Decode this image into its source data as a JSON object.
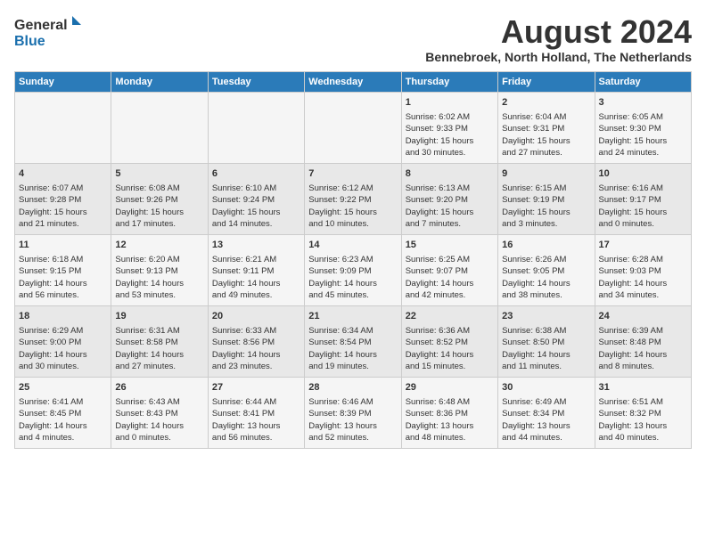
{
  "header": {
    "logo": {
      "general": "General",
      "blue": "Blue"
    },
    "month": "August 2024",
    "location": "Bennebroek, North Holland, The Netherlands"
  },
  "weekdays": [
    "Sunday",
    "Monday",
    "Tuesday",
    "Wednesday",
    "Thursday",
    "Friday",
    "Saturday"
  ],
  "weeks": [
    [
      {
        "day": "",
        "content": ""
      },
      {
        "day": "",
        "content": ""
      },
      {
        "day": "",
        "content": ""
      },
      {
        "day": "",
        "content": ""
      },
      {
        "day": "1",
        "content": "Sunrise: 6:02 AM\nSunset: 9:33 PM\nDaylight: 15 hours\nand 30 minutes."
      },
      {
        "day": "2",
        "content": "Sunrise: 6:04 AM\nSunset: 9:31 PM\nDaylight: 15 hours\nand 27 minutes."
      },
      {
        "day": "3",
        "content": "Sunrise: 6:05 AM\nSunset: 9:30 PM\nDaylight: 15 hours\nand 24 minutes."
      }
    ],
    [
      {
        "day": "4",
        "content": "Sunrise: 6:07 AM\nSunset: 9:28 PM\nDaylight: 15 hours\nand 21 minutes."
      },
      {
        "day": "5",
        "content": "Sunrise: 6:08 AM\nSunset: 9:26 PM\nDaylight: 15 hours\nand 17 minutes."
      },
      {
        "day": "6",
        "content": "Sunrise: 6:10 AM\nSunset: 9:24 PM\nDaylight: 15 hours\nand 14 minutes."
      },
      {
        "day": "7",
        "content": "Sunrise: 6:12 AM\nSunset: 9:22 PM\nDaylight: 15 hours\nand 10 minutes."
      },
      {
        "day": "8",
        "content": "Sunrise: 6:13 AM\nSunset: 9:20 PM\nDaylight: 15 hours\nand 7 minutes."
      },
      {
        "day": "9",
        "content": "Sunrise: 6:15 AM\nSunset: 9:19 PM\nDaylight: 15 hours\nand 3 minutes."
      },
      {
        "day": "10",
        "content": "Sunrise: 6:16 AM\nSunset: 9:17 PM\nDaylight: 15 hours\nand 0 minutes."
      }
    ],
    [
      {
        "day": "11",
        "content": "Sunrise: 6:18 AM\nSunset: 9:15 PM\nDaylight: 14 hours\nand 56 minutes."
      },
      {
        "day": "12",
        "content": "Sunrise: 6:20 AM\nSunset: 9:13 PM\nDaylight: 14 hours\nand 53 minutes."
      },
      {
        "day": "13",
        "content": "Sunrise: 6:21 AM\nSunset: 9:11 PM\nDaylight: 14 hours\nand 49 minutes."
      },
      {
        "day": "14",
        "content": "Sunrise: 6:23 AM\nSunset: 9:09 PM\nDaylight: 14 hours\nand 45 minutes."
      },
      {
        "day": "15",
        "content": "Sunrise: 6:25 AM\nSunset: 9:07 PM\nDaylight: 14 hours\nand 42 minutes."
      },
      {
        "day": "16",
        "content": "Sunrise: 6:26 AM\nSunset: 9:05 PM\nDaylight: 14 hours\nand 38 minutes."
      },
      {
        "day": "17",
        "content": "Sunrise: 6:28 AM\nSunset: 9:03 PM\nDaylight: 14 hours\nand 34 minutes."
      }
    ],
    [
      {
        "day": "18",
        "content": "Sunrise: 6:29 AM\nSunset: 9:00 PM\nDaylight: 14 hours\nand 30 minutes."
      },
      {
        "day": "19",
        "content": "Sunrise: 6:31 AM\nSunset: 8:58 PM\nDaylight: 14 hours\nand 27 minutes."
      },
      {
        "day": "20",
        "content": "Sunrise: 6:33 AM\nSunset: 8:56 PM\nDaylight: 14 hours\nand 23 minutes."
      },
      {
        "day": "21",
        "content": "Sunrise: 6:34 AM\nSunset: 8:54 PM\nDaylight: 14 hours\nand 19 minutes."
      },
      {
        "day": "22",
        "content": "Sunrise: 6:36 AM\nSunset: 8:52 PM\nDaylight: 14 hours\nand 15 minutes."
      },
      {
        "day": "23",
        "content": "Sunrise: 6:38 AM\nSunset: 8:50 PM\nDaylight: 14 hours\nand 11 minutes."
      },
      {
        "day": "24",
        "content": "Sunrise: 6:39 AM\nSunset: 8:48 PM\nDaylight: 14 hours\nand 8 minutes."
      }
    ],
    [
      {
        "day": "25",
        "content": "Sunrise: 6:41 AM\nSunset: 8:45 PM\nDaylight: 14 hours\nand 4 minutes."
      },
      {
        "day": "26",
        "content": "Sunrise: 6:43 AM\nSunset: 8:43 PM\nDaylight: 14 hours\nand 0 minutes."
      },
      {
        "day": "27",
        "content": "Sunrise: 6:44 AM\nSunset: 8:41 PM\nDaylight: 13 hours\nand 56 minutes."
      },
      {
        "day": "28",
        "content": "Sunrise: 6:46 AM\nSunset: 8:39 PM\nDaylight: 13 hours\nand 52 minutes."
      },
      {
        "day": "29",
        "content": "Sunrise: 6:48 AM\nSunset: 8:36 PM\nDaylight: 13 hours\nand 48 minutes."
      },
      {
        "day": "30",
        "content": "Sunrise: 6:49 AM\nSunset: 8:34 PM\nDaylight: 13 hours\nand 44 minutes."
      },
      {
        "day": "31",
        "content": "Sunrise: 6:51 AM\nSunset: 8:32 PM\nDaylight: 13 hours\nand 40 minutes."
      }
    ]
  ]
}
